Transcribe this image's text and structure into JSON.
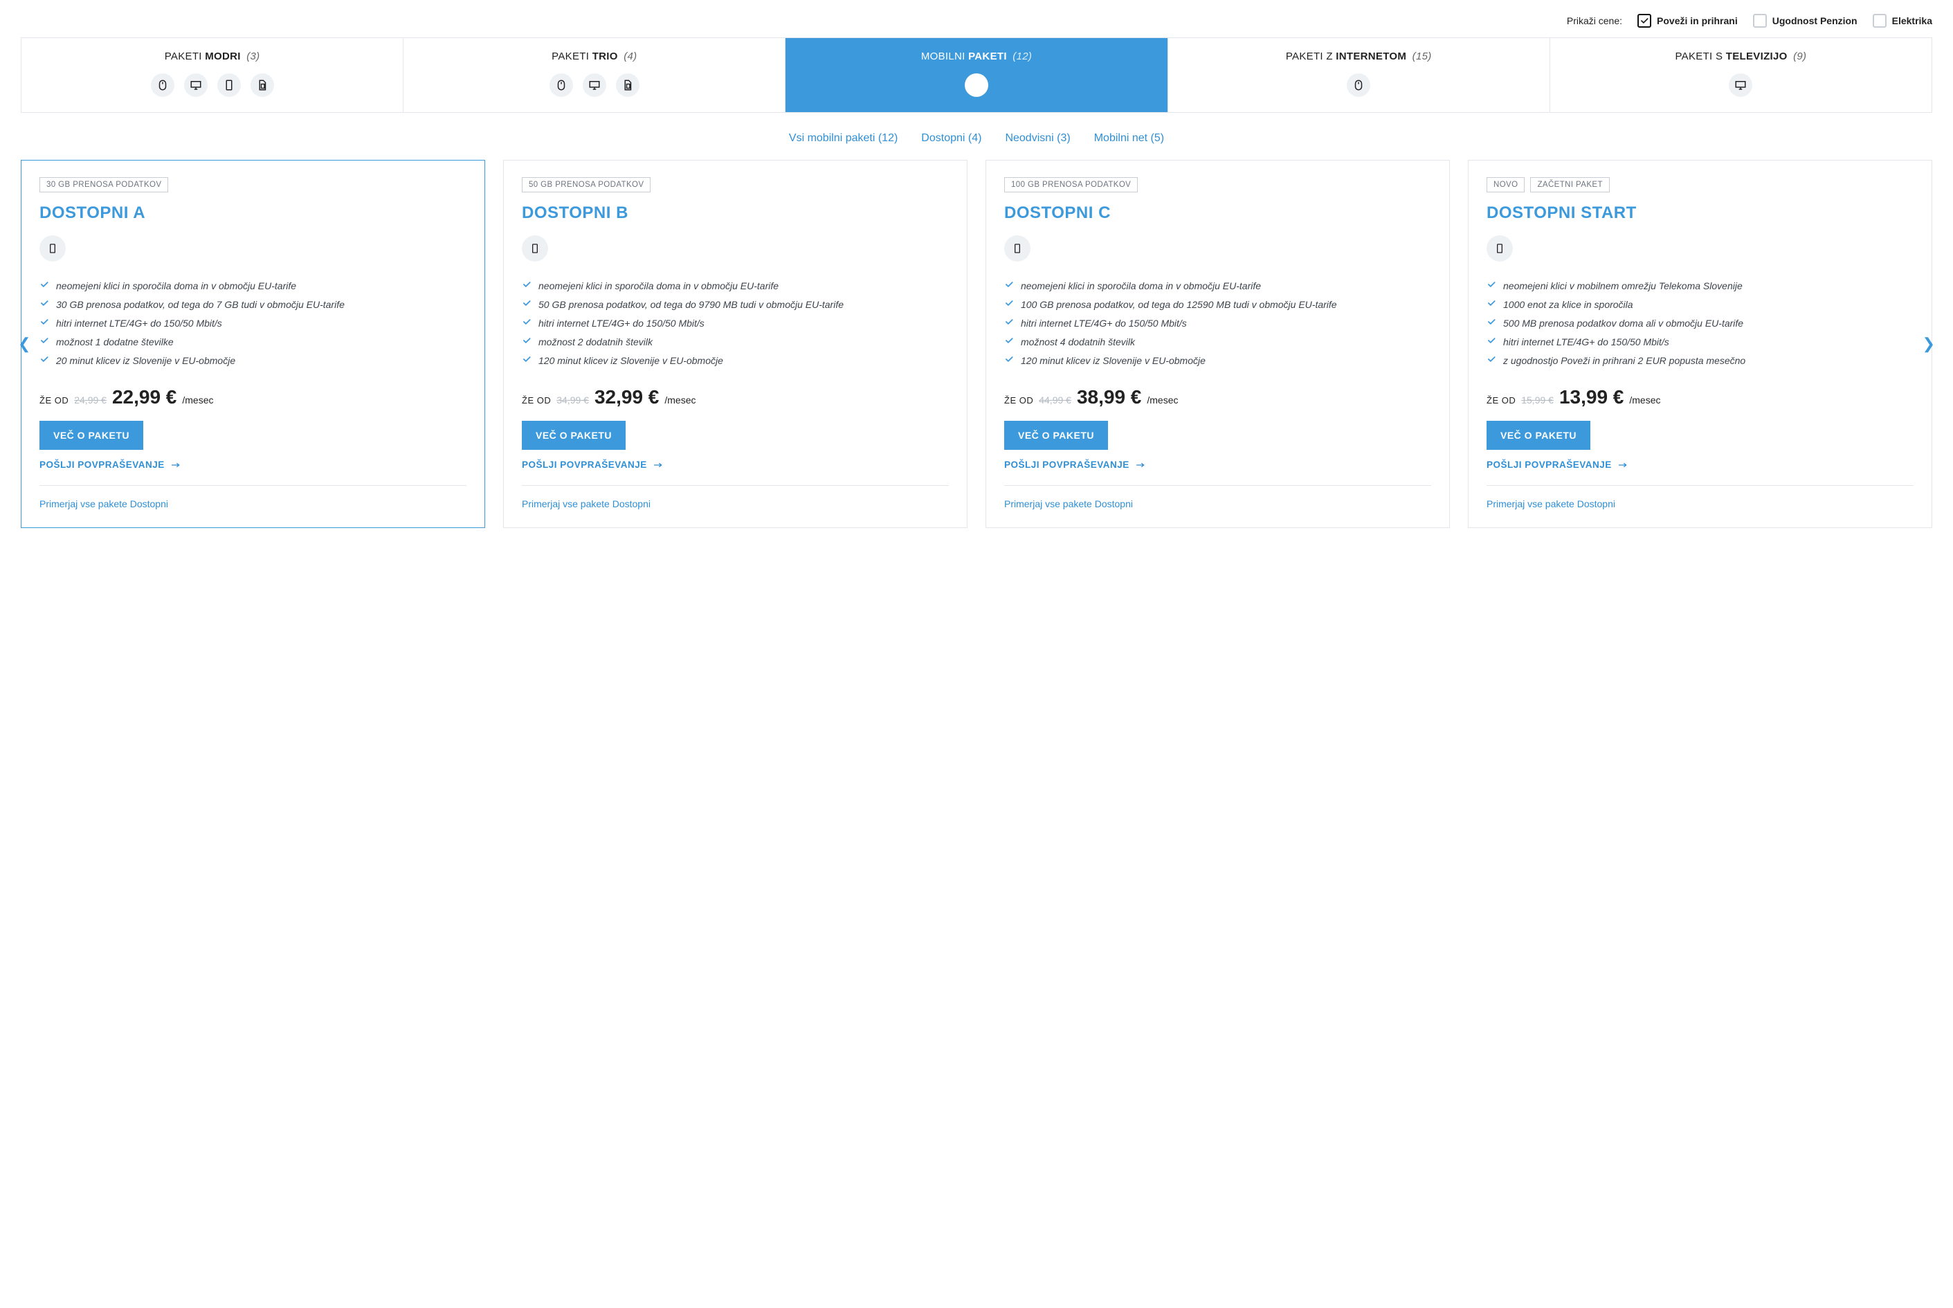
{
  "priceToggles": {
    "label": "Prikaži cene:",
    "options": [
      {
        "id": "povezi",
        "text": "Poveži in prihrani",
        "checked": true
      },
      {
        "id": "penzion",
        "text": "Ugodnost Penzion",
        "checked": false
      },
      {
        "id": "elektrika",
        "text": "Elektrika",
        "checked": false
      }
    ]
  },
  "tabs": [
    {
      "prefix": "PAKETI ",
      "strong": "MODRI",
      "count": "(3)",
      "icons": [
        "mouse",
        "monitor",
        "phone",
        "sim"
      ],
      "active": false
    },
    {
      "prefix": "PAKETI ",
      "strong": "TRIO",
      "count": "(4)",
      "icons": [
        "mouse",
        "monitor",
        "sim"
      ],
      "active": false
    },
    {
      "prefix": "MOBILNI ",
      "strong": "PAKETI",
      "count": "(12)",
      "icons": [
        "phone"
      ],
      "active": true
    },
    {
      "prefix": "PAKETI Z ",
      "strong": "INTERNETOM",
      "count": "(15)",
      "icons": [
        "mouse"
      ],
      "active": false
    },
    {
      "prefix": "PAKETI S ",
      "strong": "TELEVIZIJO",
      "count": "(9)",
      "icons": [
        "monitor"
      ],
      "active": false
    }
  ],
  "subfilters": [
    "Vsi mobilni paketi (12)",
    "Dostopni (4)",
    "Neodvisni (3)",
    "Mobilni net (5)"
  ],
  "packages": [
    {
      "highlight": true,
      "badges": [
        "30 GB PRENOSA PODATKOV"
      ],
      "title": "DOSTOPNI A",
      "features": [
        "neomejeni klici in sporočila doma in v območju EU-tarife",
        "30 GB prenosa podatkov, od tega do 7 GB tudi v območju EU-tarife",
        "hitri internet LTE/4G+ do 150/50 Mbit/s",
        "možnost 1 dodatne številke",
        "20 minut klicev iz Slovenije v EU-območje"
      ],
      "priceLead": "ŽE OD",
      "oldPrice": "24,99 €",
      "price": "22,99 €",
      "per": "/mesec",
      "cta": "VEČ O PAKETU",
      "inquiry": "POŠLJI POVPRAŠEVANJE",
      "compare": "Primerjaj vse pakete Dostopni"
    },
    {
      "highlight": false,
      "badges": [
        "50 GB PRENOSA PODATKOV"
      ],
      "title": "DOSTOPNI B",
      "features": [
        "neomejeni klici in sporočila doma in v območju EU-tarife",
        "50 GB prenosa podatkov, od tega do 9790 MB tudi v območju EU-tarife",
        "hitri internet LTE/4G+ do 150/50 Mbit/s",
        "možnost 2 dodatnih številk",
        "120 minut klicev iz Slovenije v EU-območje"
      ],
      "priceLead": "ŽE OD",
      "oldPrice": "34,99 €",
      "price": "32,99 €",
      "per": "/mesec",
      "cta": "VEČ O PAKETU",
      "inquiry": "POŠLJI POVPRAŠEVANJE",
      "compare": "Primerjaj vse pakete Dostopni"
    },
    {
      "highlight": false,
      "badges": [
        "100 GB PRENOSA PODATKOV"
      ],
      "title": "DOSTOPNI C",
      "features": [
        "neomejeni klici in sporočila doma in v območju EU-tarife",
        "100 GB prenosa podatkov, od tega do 12590 MB tudi v območju EU-tarife",
        "hitri internet LTE/4G+ do 150/50 Mbit/s",
        "možnost 4 dodatnih številk",
        "120 minut klicev iz Slovenije v EU-območje"
      ],
      "priceLead": "ŽE OD",
      "oldPrice": "44,99 €",
      "price": "38,99 €",
      "per": "/mesec",
      "cta": "VEČ O PAKETU",
      "inquiry": "POŠLJI POVPRAŠEVANJE",
      "compare": "Primerjaj vse pakete Dostopni"
    },
    {
      "highlight": false,
      "badges": [
        "NOVO",
        "ZAČETNI PAKET"
      ],
      "title": "DOSTOPNI START",
      "features": [
        "neomejeni klici v mobilnem omrežju Telekoma Slovenije",
        "1000 enot za klice in sporočila",
        "500 MB prenosa podatkov doma ali v območju EU-tarife",
        "hitri internet LTE/4G+ do 150/50 Mbit/s",
        "z ugodnostjo Poveži in prihrani 2 EUR popusta mesečno"
      ],
      "priceLead": "ŽE OD",
      "oldPrice": "15,99 €",
      "price": "13,99 €",
      "per": "/mesec",
      "cta": "VEČ O PAKETU",
      "inquiry": "POŠLJI POVPRAŠEVANJE",
      "compare": "Primerjaj vse pakete Dostopni"
    }
  ]
}
